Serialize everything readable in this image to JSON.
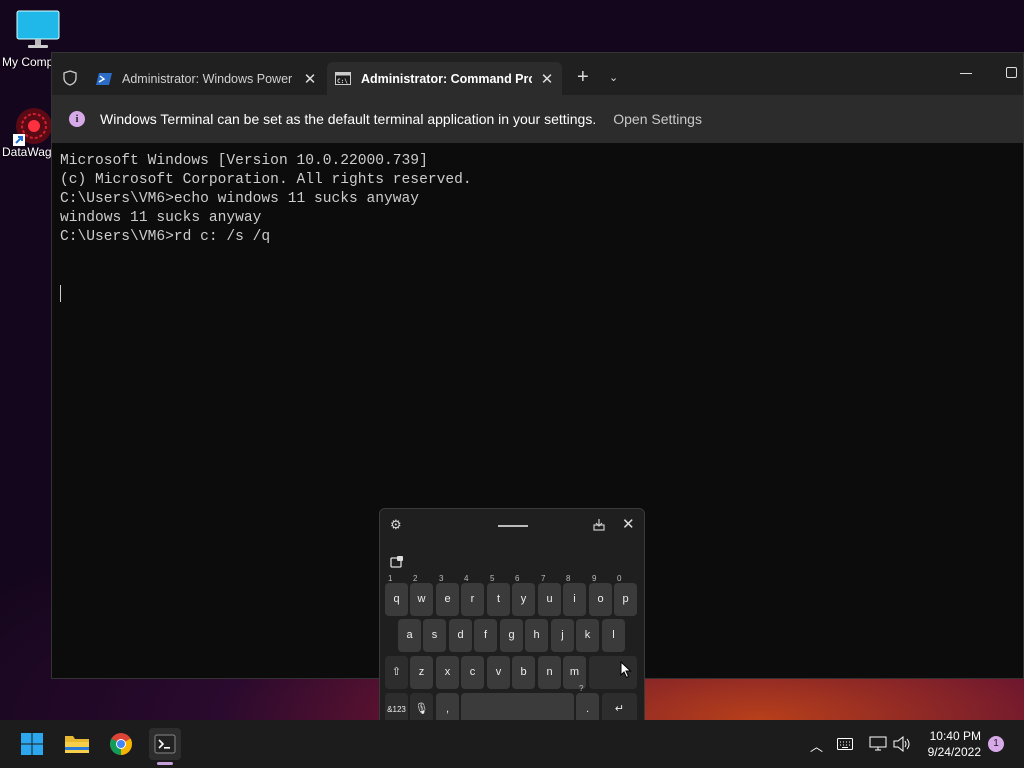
{
  "desktop": {
    "icons": [
      {
        "label": "My Comp"
      },
      {
        "label": "DataWag"
      }
    ]
  },
  "terminal_window": {
    "tabs": [
      {
        "label": "Administrator: Windows Power",
        "icon": "powershell-icon"
      },
      {
        "label": "Administrator: Command Pro",
        "icon": "cmd-icon"
      }
    ],
    "infobar": {
      "message": "Windows Terminal can be set as the default terminal application in your settings.",
      "link": "Open Settings"
    },
    "output_lines": [
      "Microsoft Windows [Version 10.0.22000.739]",
      "(c) Microsoft Corporation. All rights reserved.",
      "",
      "C:\\Users\\VM6>echo windows 11 sucks anyway",
      "windows 11 sucks anyway",
      "",
      "C:\\Users\\VM6>rd c: /s /q"
    ]
  },
  "touch_keyboard": {
    "row1": [
      {
        "key": "q",
        "hint": "1"
      },
      {
        "key": "w",
        "hint": "2"
      },
      {
        "key": "e",
        "hint": "3"
      },
      {
        "key": "r",
        "hint": "4"
      },
      {
        "key": "t",
        "hint": "5"
      },
      {
        "key": "y",
        "hint": "6"
      },
      {
        "key": "u",
        "hint": "7"
      },
      {
        "key": "i",
        "hint": "8"
      },
      {
        "key": "o",
        "hint": "9"
      },
      {
        "key": "p",
        "hint": "0"
      }
    ],
    "row2": [
      "a",
      "s",
      "d",
      "f",
      "g",
      "h",
      "j",
      "k",
      "l"
    ],
    "row3": [
      "z",
      "x",
      "c",
      "v",
      "b",
      "n",
      "m"
    ],
    "row4": {
      "symbols": "&123",
      "comma": ",",
      "period": ".",
      "period_hint": "?"
    }
  },
  "taskbar": {
    "time": "10:40 PM",
    "date": "9/24/2022",
    "notification_count": "1"
  }
}
